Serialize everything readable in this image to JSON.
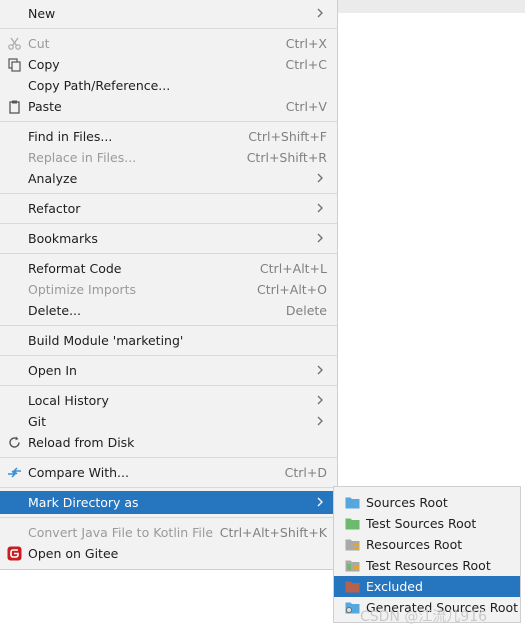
{
  "context_menu": {
    "new": "New",
    "cut": "Cut",
    "cut_shortcut": "Ctrl+X",
    "copy": "Copy",
    "copy_shortcut": "Ctrl+C",
    "copy_path": "Copy Path/Reference...",
    "paste": "Paste",
    "paste_shortcut": "Ctrl+V",
    "find_in_files": "Find in Files...",
    "find_in_files_shortcut": "Ctrl+Shift+F",
    "replace_in_files": "Replace in Files...",
    "replace_in_files_shortcut": "Ctrl+Shift+R",
    "analyze": "Analyze",
    "refactor": "Refactor",
    "bookmarks": "Bookmarks",
    "reformat_code": "Reformat Code",
    "reformat_code_shortcut": "Ctrl+Alt+L",
    "optimize_imports": "Optimize Imports",
    "optimize_imports_shortcut": "Ctrl+Alt+O",
    "delete": "Delete...",
    "delete_shortcut": "Delete",
    "build_module": "Build Module 'marketing'",
    "open_in": "Open In",
    "local_history": "Local History",
    "git": "Git",
    "reload_from_disk": "Reload from Disk",
    "compare_with": "Compare With...",
    "compare_with_shortcut": "Ctrl+D",
    "mark_directory_as": "Mark Directory as",
    "convert_java_to_kotlin": "Convert Java File to Kotlin File",
    "convert_java_to_kotlin_shortcut": "Ctrl+Alt+Shift+K",
    "open_on_gitee": "Open on Gitee"
  },
  "submenu": {
    "sources_root": "Sources Root",
    "test_sources_root": "Test Sources Root",
    "resources_root": "Resources Root",
    "test_resources_root": "Test Resources Root",
    "excluded": "Excluded",
    "generated_sources_root": "Generated Sources Root"
  },
  "watermark": "CSDN @江流儿916",
  "colors": {
    "selection": "#2675bf",
    "menu_bg": "#f2f2f2",
    "disabled_text": "#9a9a9a",
    "gitee_red": "#c71d23"
  }
}
